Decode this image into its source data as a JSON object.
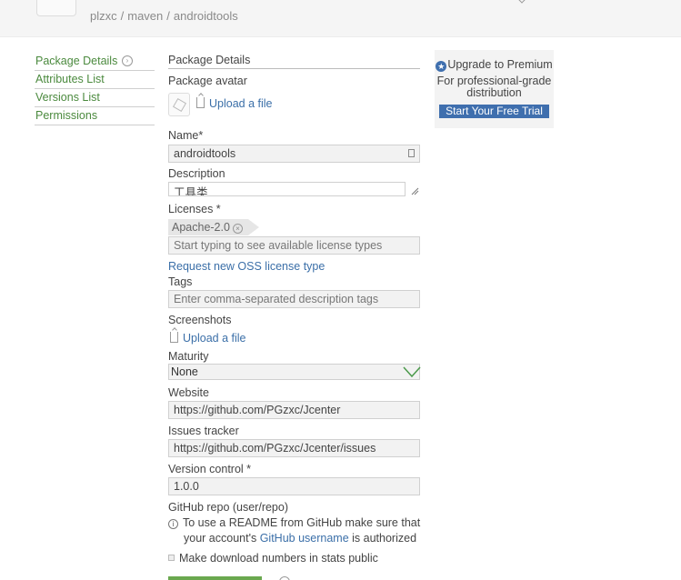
{
  "breadcrumb": {
    "owner": "plzxc",
    "repo": "maven",
    "package": "androidtools",
    "separator": "/"
  },
  "sidebar": {
    "items": [
      {
        "label": "Package Details"
      },
      {
        "label": "Attributes List"
      },
      {
        "label": "Versions List"
      },
      {
        "label": "Permissions"
      }
    ]
  },
  "form": {
    "section_title": "Package Details",
    "avatar_label": "Package avatar",
    "upload_label": "Upload a file",
    "name": {
      "label": "Name*",
      "value": "androidtools"
    },
    "description": {
      "label": "Description",
      "value": "工具类"
    },
    "licenses": {
      "label": "Licenses *",
      "tags": [
        "Apache-2.0"
      ],
      "placeholder": "Start typing to see available license types",
      "request_link": "Request new OSS license type"
    },
    "tags": {
      "label": "Tags",
      "placeholder": "Enter comma-separated description tags"
    },
    "screenshots": {
      "label": "Screenshots",
      "upload_label": "Upload a file"
    },
    "maturity": {
      "label": "Maturity",
      "value": "None"
    },
    "website": {
      "label": "Website",
      "value": "https://github.com/PGzxc/Jcenter"
    },
    "issues": {
      "label": "Issues tracker",
      "value": "https://github.com/PGzxc/Jcenter/issues"
    },
    "vcs": {
      "label": "Version control *",
      "value": "1.0.0"
    },
    "github": {
      "label": "GitHub repo (user/repo)",
      "info_line1": "To use a README from GitHub make sure that",
      "info_line2_pre": "your account's",
      "info_link": "GitHub username",
      "info_line2_post": "is authorized"
    },
    "stats_public_label": "Make download numbers in stats public"
  },
  "promo": {
    "title": "Upgrade to Premium",
    "subtitle_line1": "For professional-grade",
    "subtitle_line2": "distribution",
    "button": "Start Your Free Trial"
  },
  "colors": {
    "link_green": "#4b8a3e",
    "link_blue": "#3b6fa8",
    "brand_blue": "#3f6fae"
  }
}
